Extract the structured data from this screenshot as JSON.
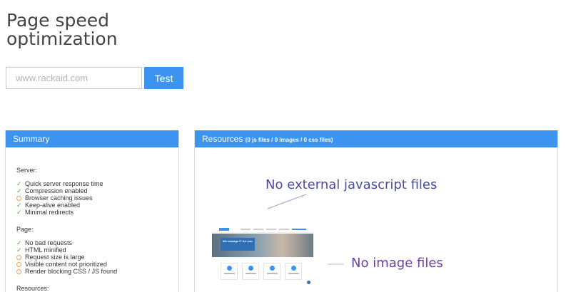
{
  "page": {
    "title_line1": "Page speed",
    "title_line2": "optimization"
  },
  "search": {
    "placeholder": "www.rackaid.com",
    "button_label": "Test"
  },
  "summary": {
    "header": "Summary",
    "server": {
      "title": "Server:",
      "items": [
        {
          "label": "Quick server response time",
          "status": "ok"
        },
        {
          "label": "Compression enabled",
          "status": "ok"
        },
        {
          "label": "Browser caching issues",
          "status": "warn"
        },
        {
          "label": "Keep-alive enabled",
          "status": "ok"
        },
        {
          "label": "Minimal redirects",
          "status": "ok"
        }
      ]
    },
    "page_section": {
      "title": "Page:",
      "items": [
        {
          "label": "No bad requests",
          "status": "ok"
        },
        {
          "label": "HTML minified",
          "status": "ok"
        },
        {
          "label": "Request size is large",
          "status": "warn"
        },
        {
          "label": "Visible content not prioritized",
          "status": "warn"
        },
        {
          "label": "Render blocking CSS / JS found",
          "status": "warn"
        }
      ]
    },
    "resources_title": "Resources:"
  },
  "resources": {
    "header": "Resources",
    "counts": "(0 js files / 0 images / 0 css files)",
    "js_note": "No external javascript files",
    "image_note": "No image files",
    "thumbnail": {
      "hero_text": "We manage IT for you."
    }
  },
  "colors": {
    "accent": "#3d93f0",
    "ok": "#4caf50",
    "warn": "#f0a050"
  }
}
